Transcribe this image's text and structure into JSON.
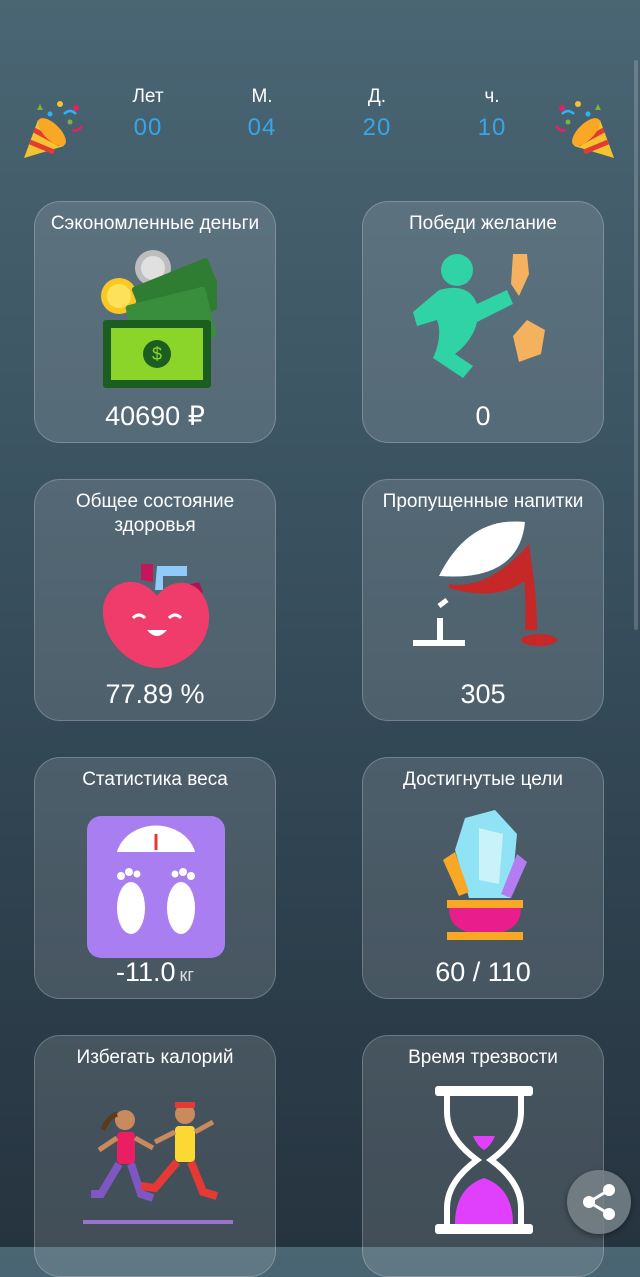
{
  "counter": {
    "years": {
      "label": "Лет",
      "value": "00"
    },
    "months": {
      "label": "М.",
      "value": "04"
    },
    "days": {
      "label": "Д.",
      "value": "20"
    },
    "hours": {
      "label": "ч.",
      "value": "10"
    }
  },
  "cards": [
    {
      "title": "Сэкономленные деньги",
      "value": "40690 ₽",
      "icon": "money-icon"
    },
    {
      "title": "Победи желание",
      "value": "0",
      "icon": "kick-bottle-icon"
    },
    {
      "title": "Общее состояние здоровья",
      "value": "77.89 %",
      "icon": "heart-icon"
    },
    {
      "title": "Пропущенные напитки",
      "value": "305",
      "icon": "spilled-wine-icon"
    },
    {
      "title": "Статистика веса",
      "value": "-11.0",
      "unit": "кг",
      "icon": "scale-icon"
    },
    {
      "title": "Достигнутые цели",
      "value": "60 / 110",
      "icon": "trophy-crystal-icon"
    },
    {
      "title": "Избегать калорий",
      "value": "",
      "icon": "runners-icon"
    },
    {
      "title": "Время трезвости",
      "value": "",
      "icon": "hourglass-icon"
    }
  ],
  "colors": {
    "accent": "#35a7e8"
  }
}
